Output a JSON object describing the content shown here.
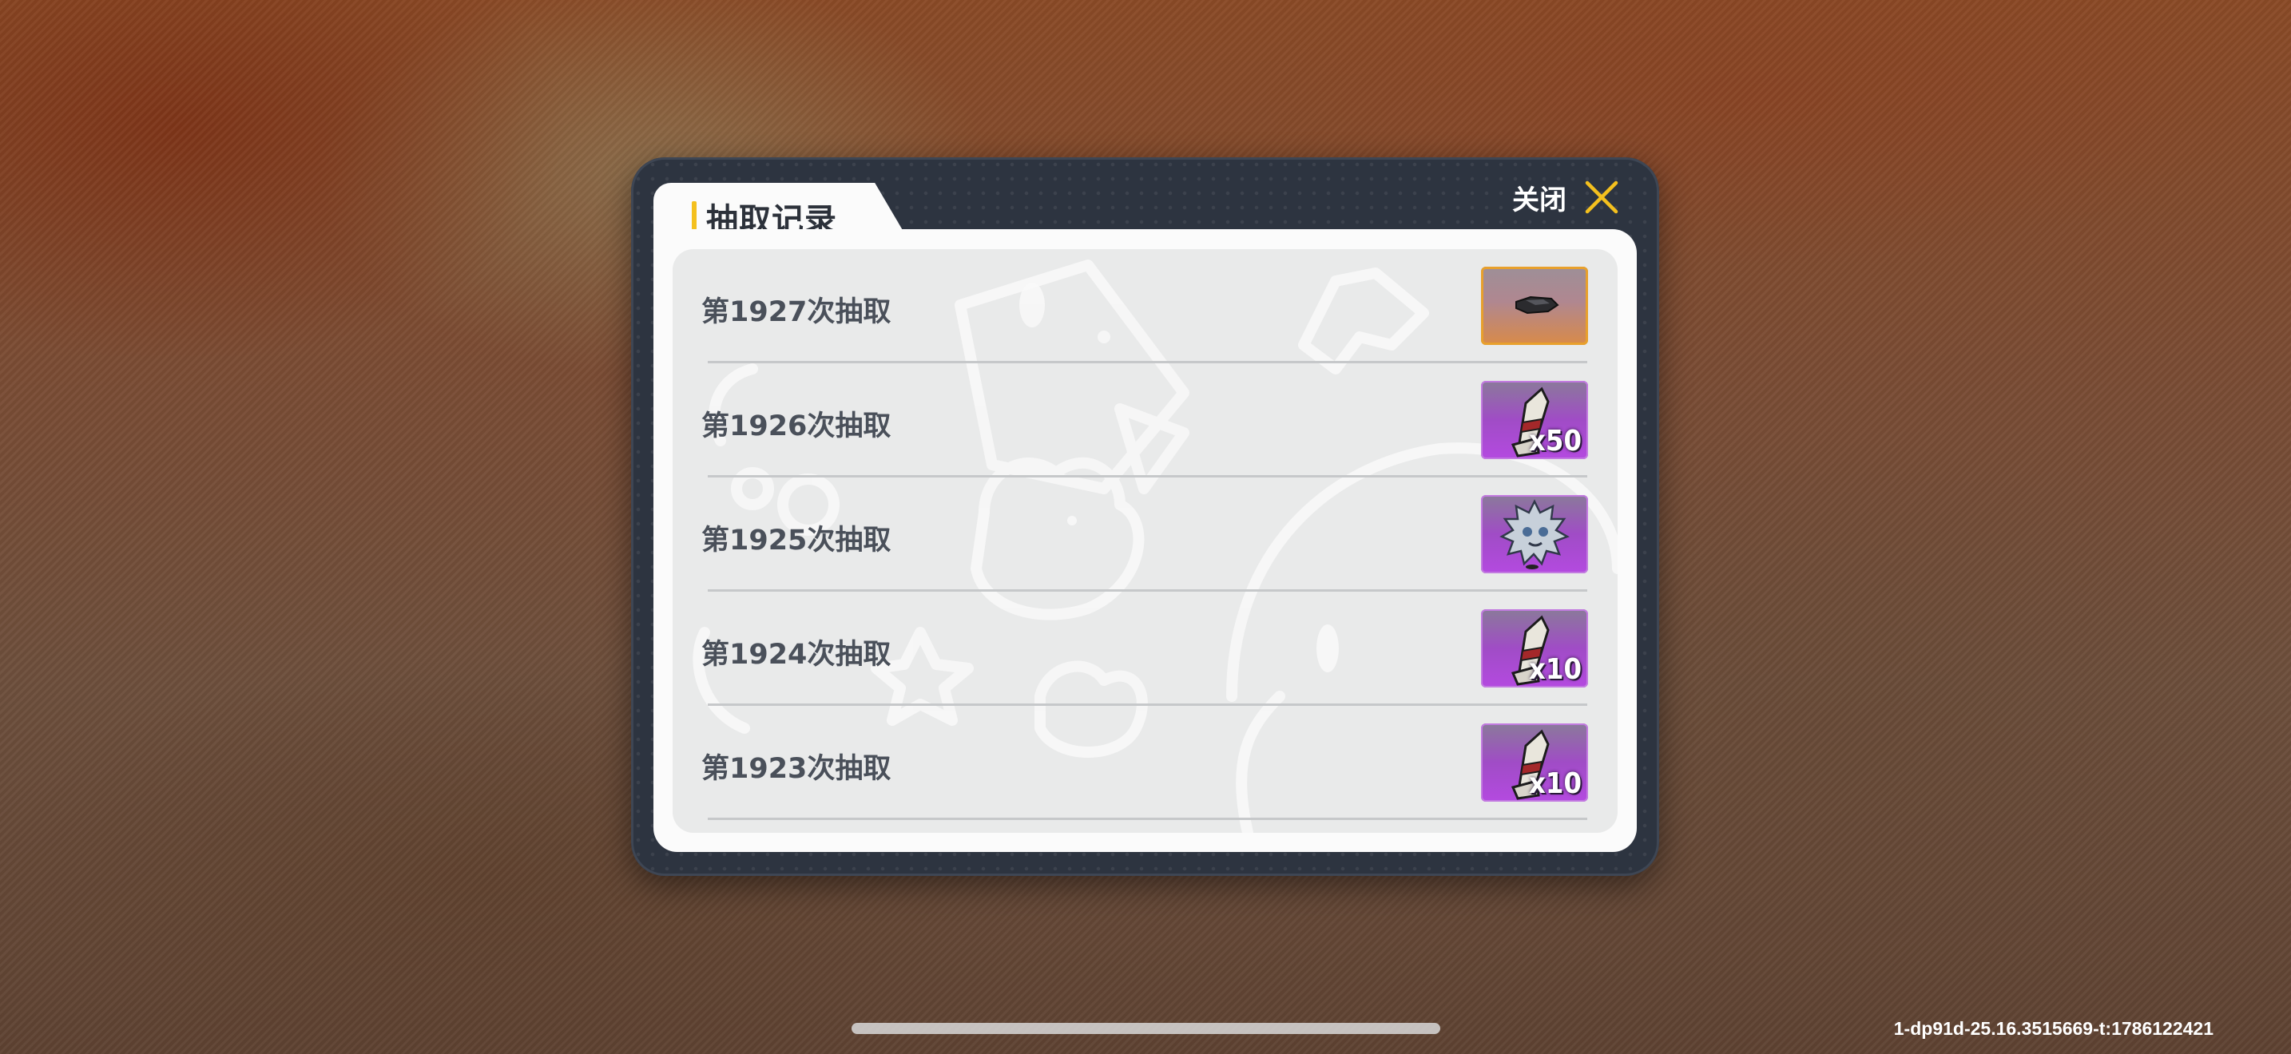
{
  "dialog": {
    "title": "抽取记录",
    "close_label": "关闭",
    "accent_color": "#f4c01e"
  },
  "records": [
    {
      "label": "第1927次抽取",
      "item_icon": "stone-icon",
      "rarity": "orange",
      "quantity": ""
    },
    {
      "label": "第1926次抽取",
      "item_icon": "scroll-icon",
      "rarity": "purple",
      "quantity": "x50"
    },
    {
      "label": "第1925次抽取",
      "item_icon": "spiky-creature-icon",
      "rarity": "purple",
      "quantity": ""
    },
    {
      "label": "第1924次抽取",
      "item_icon": "scroll-icon",
      "rarity": "purple",
      "quantity": "x10"
    },
    {
      "label": "第1923次抽取",
      "item_icon": "scroll-icon",
      "rarity": "purple",
      "quantity": "x10"
    }
  ],
  "build_id": "1-dp91d-25.16.3515669-t:1786122421"
}
